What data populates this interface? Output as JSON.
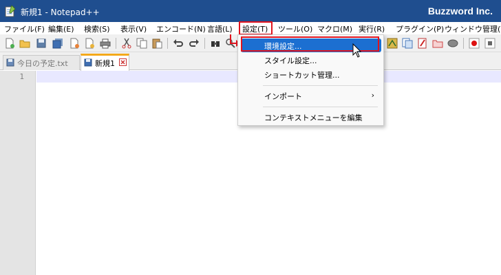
{
  "window": {
    "title": "新規1 - Notepad++",
    "brand": "Buzzword Inc."
  },
  "menubar": {
    "items": [
      "ファイル(F)",
      "編集(E)",
      "検索(S)",
      "表示(V)",
      "エンコード(N)",
      "言語(L)",
      "設定(T)",
      "ツール(O)",
      "マクロ(M)",
      "実行(R)",
      "プラグイン(P)",
      "ウィンドウ管理(W)"
    ]
  },
  "tabs": [
    {
      "label": "今日の予定.txt",
      "state": "inactive"
    },
    {
      "label": "新規1",
      "state": "active"
    }
  ],
  "editor": {
    "line_number": "1"
  },
  "settings_menu": {
    "items": [
      {
        "label": "環境設定...",
        "highlighted": true
      },
      {
        "label": "スタイル設定..."
      },
      {
        "label": "ショートカット管理..."
      },
      {
        "label": "インポート",
        "submenu_arrow": "›"
      },
      {
        "label": "コンテキストメニューを編集"
      }
    ]
  },
  "colors": {
    "titlebar": "#1f4e8f",
    "highlight": "#1c6fd1",
    "annotation": "#e0141e",
    "active_tab_accent": "#f4a91a"
  },
  "icons": [
    "notepad-app-icon",
    "new-file-icon",
    "open-file-icon",
    "save-icon",
    "save-all-icon",
    "close-icon",
    "close-all-icon",
    "print-icon",
    "cut-icon",
    "copy-icon",
    "paste-icon",
    "undo-icon",
    "redo-icon",
    "find-icon",
    "mouse-cursor-icon"
  ]
}
